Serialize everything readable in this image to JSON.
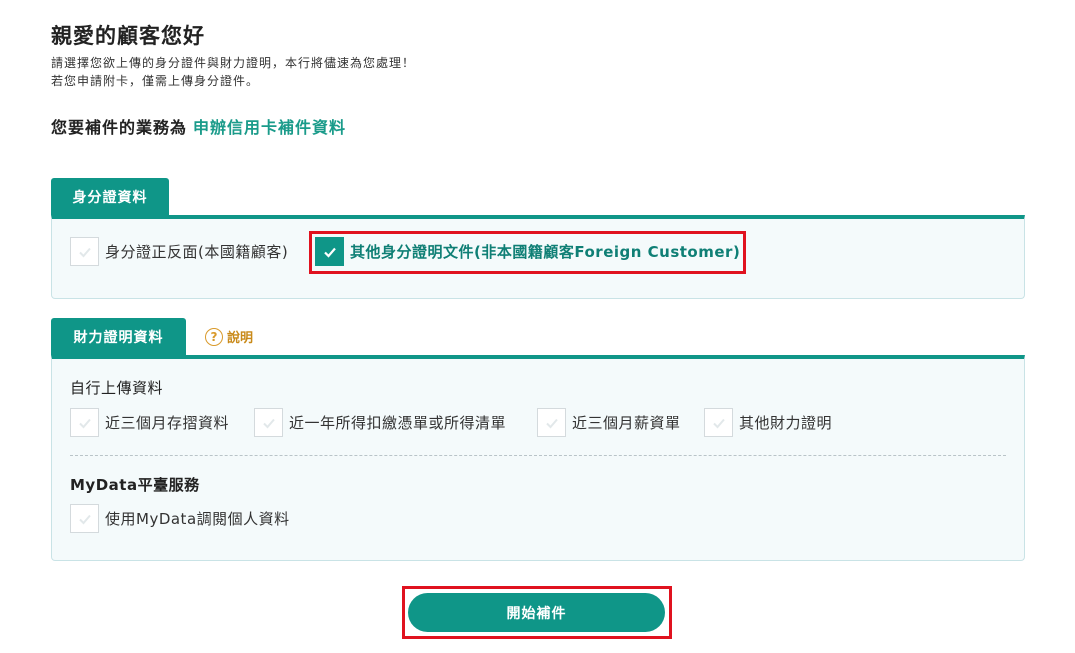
{
  "header": {
    "greeting": "親愛的顧客您好",
    "desc_line1": "請選擇您欲上傳的身分證件與財力證明，本行將儘速為您處理！",
    "desc_line2": "若您申請附卡，僅需上傳身分證件。"
  },
  "business": {
    "label": "您要補件的業務為",
    "value": "申辦信用卡補件資料"
  },
  "identity_section": {
    "tab_label": "身分證資料",
    "options": [
      {
        "label": "身分證正反面(本國籍顧客)",
        "checked": false
      },
      {
        "label": "其他身分證明文件(非本國籍顧客Foreign Customer)",
        "checked": true
      }
    ]
  },
  "financial_section": {
    "tab_label": "財力證明資料",
    "help_label": "說明",
    "help_icon": "question-circle-icon",
    "self_upload_title": "自行上傳資料",
    "self_upload_options": [
      {
        "label": "近三個月存摺資料",
        "checked": false
      },
      {
        "label": "近一年所得扣繳憑單或所得清單",
        "checked": false
      },
      {
        "label": "近三個月薪資單",
        "checked": false
      },
      {
        "label": "其他財力證明",
        "checked": false
      }
    ],
    "mydata_title": "MyData平臺服務",
    "mydata_options": [
      {
        "label": "使用MyData調閱個人資料",
        "checked": false
      }
    ]
  },
  "actions": {
    "start_label": "開始補件"
  },
  "colors": {
    "accent": "#0f9688",
    "highlight": "#e0121f",
    "help": "#d99a2b"
  }
}
